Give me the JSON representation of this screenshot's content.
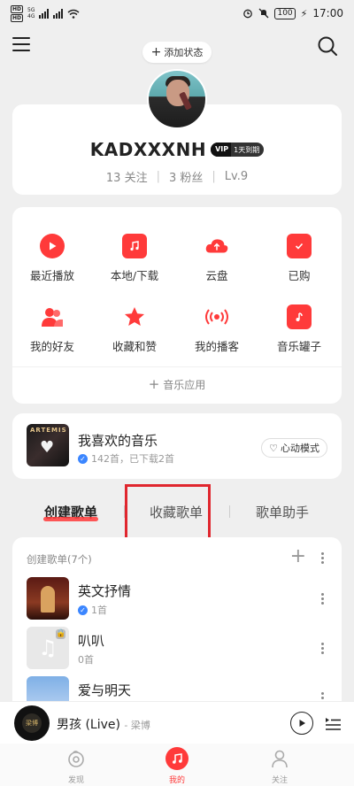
{
  "status_bar": {
    "hd1": "HD",
    "hd2": "HD",
    "net1": "5G",
    "net2": "4G",
    "battery": "100",
    "time": "17:00"
  },
  "header": {
    "add_status": "添加状态"
  },
  "profile": {
    "username": "KADXXXNH",
    "vip_logo": "VIP",
    "vip_text": "1天到期",
    "follows": "13 关注",
    "fans": "3 粉丝",
    "level": "Lv.9"
  },
  "functions": {
    "items": [
      {
        "label": "最近播放",
        "icon": "play-icon"
      },
      {
        "label": "本地/下载",
        "icon": "music-file-icon"
      },
      {
        "label": "云盘",
        "icon": "cloud-upload-icon"
      },
      {
        "label": "已购",
        "icon": "shopping-bag-icon"
      },
      {
        "label": "我的好友",
        "icon": "friends-icon"
      },
      {
        "label": "收藏和赞",
        "icon": "star-icon"
      },
      {
        "label": "我的播客",
        "icon": "broadcast-icon"
      },
      {
        "label": "音乐罐子",
        "icon": "music-jar-icon"
      }
    ],
    "music_app": "音乐应用"
  },
  "liked": {
    "title": "我喜欢的音乐",
    "subtitle": "142首，已下载2首",
    "cover_text": "ARTEMIS",
    "heart_mode": "心动模式"
  },
  "tabs": [
    {
      "label": "创建歌单",
      "active": true
    },
    {
      "label": "收藏歌单",
      "active": false
    },
    {
      "label": "歌单助手",
      "active": false
    }
  ],
  "playlists": {
    "header": "创建歌单(7个)",
    "items": [
      {
        "title": "英文抒情",
        "count": "1首"
      },
      {
        "title": "叭叭",
        "count": "0首"
      },
      {
        "title": "爱与明天",
        "count": ""
      }
    ]
  },
  "player": {
    "title": "男孩 (Live)",
    "artist": "- 梁博",
    "disc_text": "梁博"
  },
  "bottom_nav": [
    {
      "label": "发现",
      "active": false
    },
    {
      "label": "我的",
      "active": true
    },
    {
      "label": "关注",
      "active": false
    }
  ],
  "colors": {
    "accent": "#ff3a3a",
    "background": "#efefef",
    "highlight_box": "#e0262e",
    "check_blue": "#3b86ff"
  }
}
